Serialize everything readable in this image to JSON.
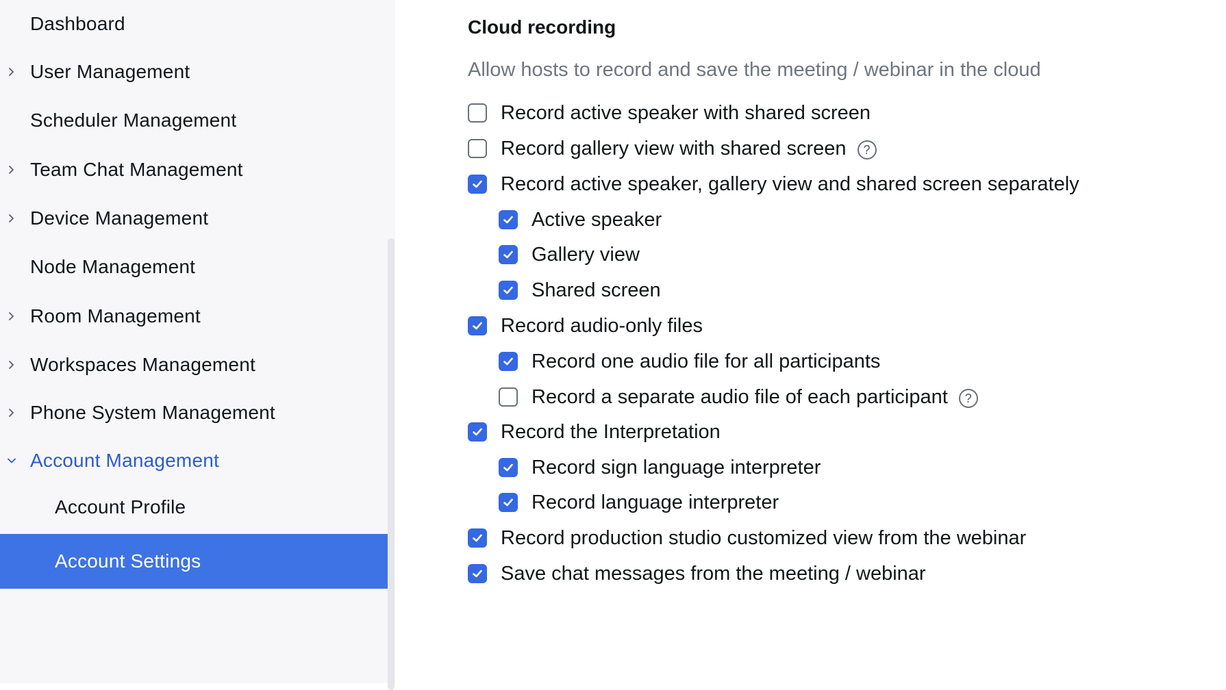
{
  "sidebar": {
    "items": [
      {
        "label": "Dashboard",
        "chevron": "none"
      },
      {
        "label": "User Management",
        "chevron": "right"
      },
      {
        "label": "Scheduler Management",
        "chevron": "none"
      },
      {
        "label": "Team Chat Management",
        "chevron": "right"
      },
      {
        "label": "Device Management",
        "chevron": "right"
      },
      {
        "label": "Node Management",
        "chevron": "none"
      },
      {
        "label": "Room Management",
        "chevron": "right"
      },
      {
        "label": "Workspaces Management",
        "chevron": "right"
      },
      {
        "label": "Phone System Management",
        "chevron": "right"
      },
      {
        "label": "Account Management",
        "chevron": "down",
        "state": "expanded"
      },
      {
        "label": "Account Profile",
        "sub": true
      },
      {
        "label": "Account Settings",
        "sub": true,
        "state": "selected"
      }
    ]
  },
  "section": {
    "title": "Cloud recording",
    "description": "Allow hosts to record and save the meeting / webinar in the cloud",
    "options": [
      {
        "label": "Record active speaker with shared screen",
        "checked": false,
        "indent": 0
      },
      {
        "label": "Record gallery view with shared screen",
        "checked": false,
        "indent": 0,
        "help": true
      },
      {
        "label": "Record active speaker, gallery view and shared screen separately",
        "checked": true,
        "indent": 0
      },
      {
        "label": "Active speaker",
        "checked": true,
        "indent": 1
      },
      {
        "label": "Gallery view",
        "checked": true,
        "indent": 1
      },
      {
        "label": "Shared screen",
        "checked": true,
        "indent": 1
      },
      {
        "label": "Record audio-only files",
        "checked": true,
        "indent": 0
      },
      {
        "label": "Record one audio file for all participants",
        "checked": true,
        "indent": 1
      },
      {
        "label": "Record a separate audio file of each participant",
        "checked": false,
        "indent": 1,
        "help": true
      },
      {
        "label": "Record the Interpretation",
        "checked": true,
        "indent": 0
      },
      {
        "label": "Record sign language interpreter",
        "checked": true,
        "indent": 1
      },
      {
        "label": "Record language interpreter",
        "checked": true,
        "indent": 1
      },
      {
        "label": "Record production studio customized view from the webinar",
        "checked": true,
        "indent": 0
      },
      {
        "label": "Save chat messages from the meeting / webinar",
        "checked": true,
        "indent": 0
      }
    ],
    "help_glyph": "?"
  },
  "colors": {
    "accent": "#3e73e6",
    "checkbox_on": "#3568e2",
    "expanded_text": "#2d5bcf",
    "description_text": "#6e7680"
  },
  "icons": {
    "chevron_right": "chevron-right-icon",
    "chevron_down": "chevron-down-icon",
    "check": "check-icon",
    "help": "help-circle-icon"
  }
}
